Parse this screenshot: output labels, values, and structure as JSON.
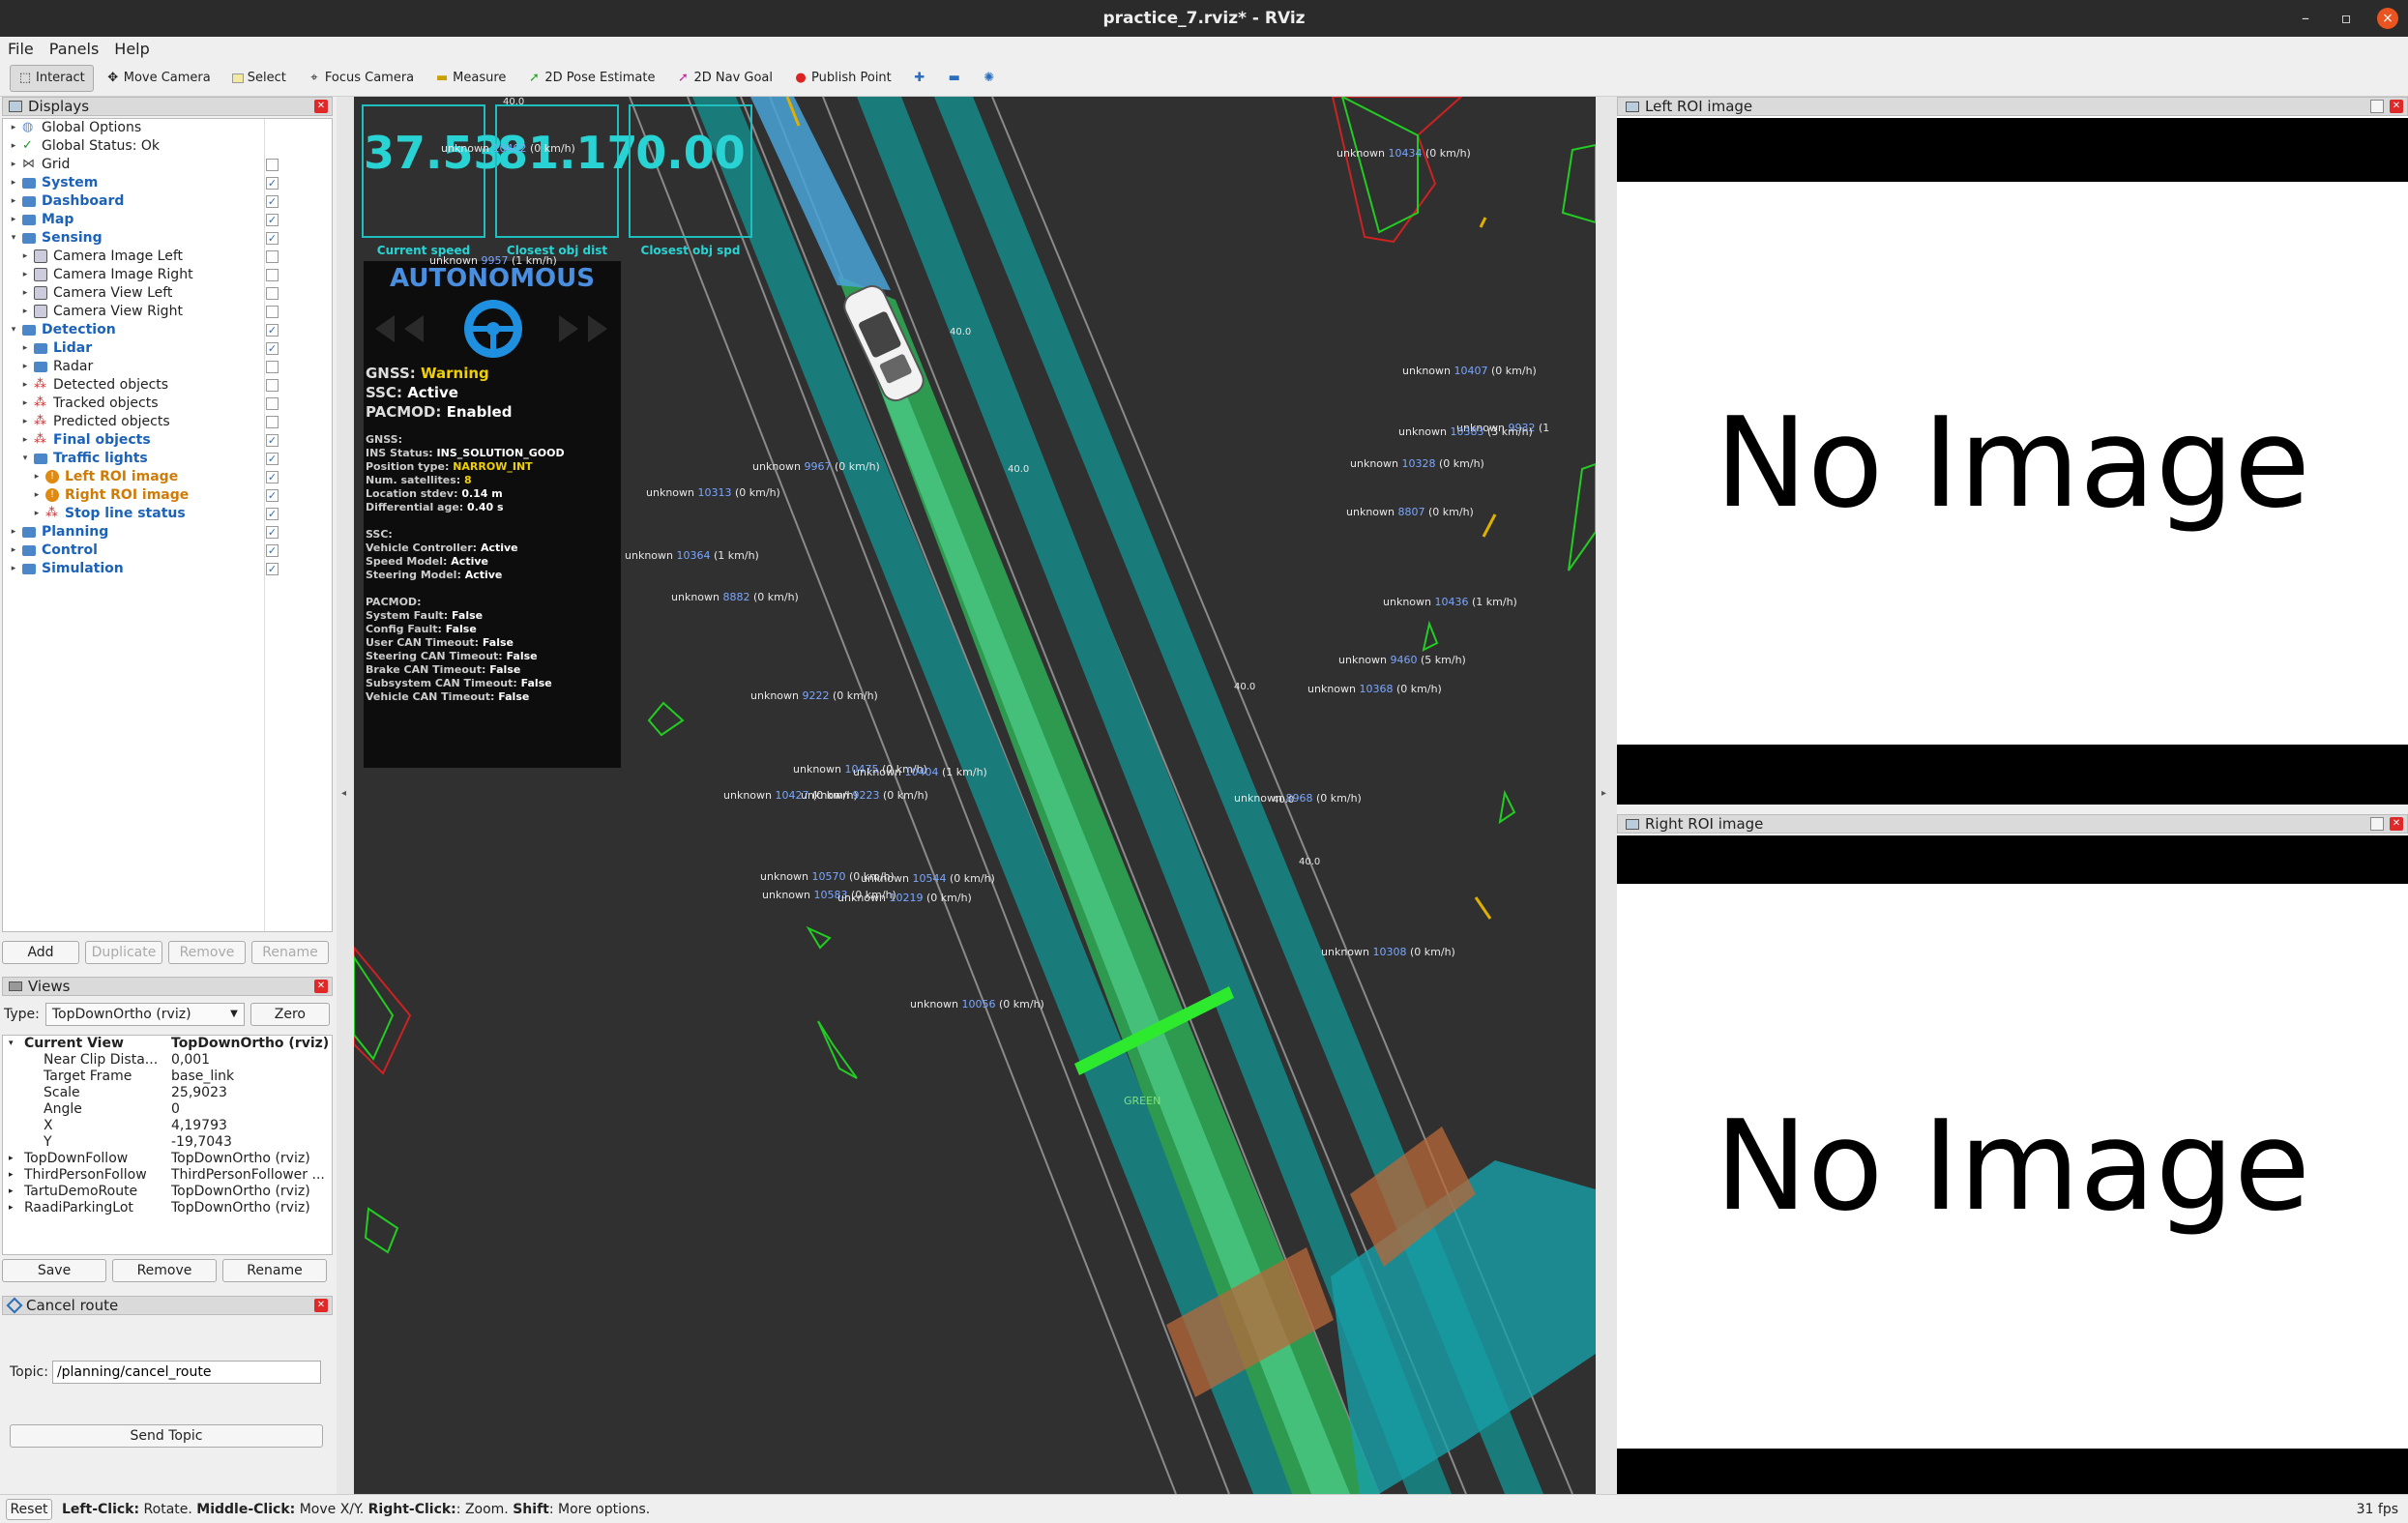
{
  "window": {
    "title": "practice_7.rviz* - RViz",
    "buttons": [
      "–",
      "▫",
      "×"
    ]
  },
  "menu": [
    "File",
    "Panels",
    "Help"
  ],
  "toolbar": [
    {
      "label": "Interact",
      "icon": "interact-icon",
      "active": true
    },
    {
      "label": "Move Camera",
      "icon": "move-camera-icon"
    },
    {
      "label": "Select",
      "icon": "select-icon"
    },
    {
      "label": "Focus Camera",
      "icon": "focus-camera-icon"
    },
    {
      "label": "Measure",
      "icon": "measure-icon"
    },
    {
      "label": "2D Pose Estimate",
      "icon": "pose-estimate-icon"
    },
    {
      "label": "2D Nav Goal",
      "icon": "nav-goal-icon"
    },
    {
      "label": "Publish Point",
      "icon": "publish-point-icon"
    }
  ],
  "displays_panel": {
    "title": "Displays",
    "items": [
      {
        "label": "Global Options",
        "depth": 0,
        "arrow": "▸",
        "style": "",
        "checked": null,
        "icon": "globe-icon"
      },
      {
        "label": "Global Status: Ok",
        "depth": 0,
        "arrow": "▸",
        "style": "",
        "checked": null,
        "icon": "check-icon"
      },
      {
        "label": "Grid",
        "depth": 0,
        "arrow": "▸",
        "style": "",
        "checked": false,
        "icon": "grid-icon"
      },
      {
        "label": "System",
        "depth": 0,
        "arrow": "▸",
        "style": "blue",
        "checked": true,
        "icon": "folder-icon"
      },
      {
        "label": "Dashboard",
        "depth": 0,
        "arrow": "▸",
        "style": "blue",
        "checked": true,
        "icon": "folder-icon"
      },
      {
        "label": "Map",
        "depth": 0,
        "arrow": "▸",
        "style": "blue",
        "checked": true,
        "icon": "folder-icon"
      },
      {
        "label": "Sensing",
        "depth": 0,
        "arrow": "▾",
        "style": "blue",
        "checked": true,
        "icon": "folder-icon"
      },
      {
        "label": "Camera Image Left",
        "depth": 1,
        "arrow": "▸",
        "style": "",
        "checked": false,
        "icon": "camera-icon"
      },
      {
        "label": "Camera Image Right",
        "depth": 1,
        "arrow": "▸",
        "style": "",
        "checked": false,
        "icon": "camera-icon"
      },
      {
        "label": "Camera View Left",
        "depth": 1,
        "arrow": "▸",
        "style": "",
        "checked": false,
        "icon": "camera-icon"
      },
      {
        "label": "Camera View Right",
        "depth": 1,
        "arrow": "▸",
        "style": "",
        "checked": false,
        "icon": "camera-icon"
      },
      {
        "label": "Detection",
        "depth": 0,
        "arrow": "▾",
        "style": "blue",
        "checked": true,
        "icon": "folder-icon"
      },
      {
        "label": "Lidar",
        "depth": 1,
        "arrow": "▸",
        "style": "blue",
        "checked": true,
        "icon": "folder-icon"
      },
      {
        "label": "Radar",
        "depth": 1,
        "arrow": "▸",
        "style": "",
        "checked": false,
        "icon": "folder-icon"
      },
      {
        "label": "Detected objects",
        "depth": 1,
        "arrow": "▸",
        "style": "",
        "checked": false,
        "icon": "markers-icon"
      },
      {
        "label": "Tracked objects",
        "depth": 1,
        "arrow": "▸",
        "style": "",
        "checked": false,
        "icon": "markers-icon"
      },
      {
        "label": "Predicted objects",
        "depth": 1,
        "arrow": "▸",
        "style": "",
        "checked": false,
        "icon": "markers-icon"
      },
      {
        "label": "Final objects",
        "depth": 1,
        "arrow": "▸",
        "style": "blue",
        "checked": true,
        "icon": "markers-icon"
      },
      {
        "label": "Traffic lights",
        "depth": 1,
        "arrow": "▾",
        "style": "blue",
        "checked": true,
        "icon": "folder-icon"
      },
      {
        "label": "Left ROI image",
        "depth": 2,
        "arrow": "▸",
        "style": "orange",
        "checked": true,
        "icon": "warning-icon"
      },
      {
        "label": "Right ROI image",
        "depth": 2,
        "arrow": "▸",
        "style": "orange",
        "checked": true,
        "icon": "warning-icon"
      },
      {
        "label": "Stop line status",
        "depth": 2,
        "arrow": "▸",
        "style": "blue",
        "checked": true,
        "icon": "markers-icon"
      },
      {
        "label": "Planning",
        "depth": 0,
        "arrow": "▸",
        "style": "blue",
        "checked": true,
        "icon": "folder-icon"
      },
      {
        "label": "Control",
        "depth": 0,
        "arrow": "▸",
        "style": "blue",
        "checked": true,
        "icon": "folder-icon"
      },
      {
        "label": "Simulation",
        "depth": 0,
        "arrow": "▸",
        "style": "blue",
        "checked": true,
        "icon": "folder-icon"
      }
    ],
    "buttons": [
      "Add",
      "Duplicate",
      "Remove",
      "Rename"
    ]
  },
  "views_panel": {
    "title": "Views",
    "type_label": "Type:",
    "type_value": "TopDownOrtho (rviz)",
    "zero_label": "Zero",
    "current_view": {
      "key": "Current View",
      "value": "TopDownOrtho (rviz)"
    },
    "props": [
      {
        "key": "Near Clip Dista...",
        "value": "0,001"
      },
      {
        "key": "Target Frame",
        "value": "base_link"
      },
      {
        "key": "Scale",
        "value": "25,9023"
      },
      {
        "key": "Angle",
        "value": "0"
      },
      {
        "key": "X",
        "value": "4,19793"
      },
      {
        "key": "Y",
        "value": "-19,7043"
      }
    ],
    "saved": [
      {
        "key": "TopDownFollow",
        "value": "TopDownOrtho (rviz)"
      },
      {
        "key": "ThirdPersonFollow",
        "value": "ThirdPersonFollower ..."
      },
      {
        "key": "TartuDemoRoute",
        "value": "TopDownOrtho (rviz)"
      },
      {
        "key": "RaadiParkingLot",
        "value": "TopDownOrtho (rviz)"
      }
    ],
    "buttons": [
      "Save",
      "Remove",
      "Rename"
    ]
  },
  "cancel_panel": {
    "title": "Cancel route",
    "topic_label": "Topic:",
    "topic_value": "/planning/cancel_route",
    "send_label": "Send Topic"
  },
  "dashboard": {
    "gauges": [
      {
        "value": "37.53",
        "label": "Current speed"
      },
      {
        "value": "81.17",
        "label": "Closest obj dist"
      },
      {
        "value": "0.00",
        "label": "Closest obj spd"
      }
    ],
    "mode": "AUTONOMOUS",
    "gnss_line": {
      "k": "GNSS:",
      "v": "Warning"
    },
    "ssc_line": {
      "k": "SSC:",
      "v": "Active"
    },
    "pacmod_line": {
      "k": "PACMOD:",
      "v": "Enabled"
    },
    "gnss_block": [
      {
        "k": "GNSS:",
        "v": ""
      },
      {
        "k": "INS Status:",
        "v": "INS_SOLUTION_GOOD"
      },
      {
        "k": "Position type:",
        "v": "NARROW_INT"
      },
      {
        "k": "Num. satellites:",
        "v": "8"
      },
      {
        "k": "Location stdev:",
        "v": "0.14 m"
      },
      {
        "k": "Differential age:",
        "v": "0.40 s"
      }
    ],
    "ssc_block": [
      {
        "k": "SSC:",
        "v": ""
      },
      {
        "k": "Vehicle Controller:",
        "v": "Active"
      },
      {
        "k": "Speed Model:",
        "v": "Active"
      },
      {
        "k": "Steering Model:",
        "v": "Active"
      }
    ],
    "pacmod_block": [
      {
        "k": "PACMOD:",
        "v": ""
      },
      {
        "k": "System Fault:",
        "v": "False"
      },
      {
        "k": "Config Fault:",
        "v": "False"
      },
      {
        "k": "User CAN Timeout:",
        "v": "False"
      },
      {
        "k": "Steering CAN Timeout:",
        "v": "False"
      },
      {
        "k": "Brake CAN Timeout:",
        "v": "False"
      },
      {
        "k": "Subsystem CAN Timeout:",
        "v": "False"
      },
      {
        "k": "Vehicle CAN Timeout:",
        "v": "False"
      }
    ]
  },
  "objects": [
    {
      "id": "10402",
      "speed": "(0 km/h)"
    },
    {
      "id": "10434",
      "speed": "(0 km/h)"
    },
    {
      "id": "9957",
      "speed": "(1 km/h)"
    },
    {
      "id": "10407",
      "speed": "(0 km/h)"
    },
    {
      "id": "9932",
      "speed": "(1"
    },
    {
      "id": "10383",
      "speed": "(3 km/h)"
    },
    {
      "id": "10328",
      "speed": "(0 km/h)"
    },
    {
      "id": "9967",
      "speed": "(0 km/h)"
    },
    {
      "id": "10313",
      "speed": "(0 km/h)"
    },
    {
      "id": "8807",
      "speed": "(0 km/h)"
    },
    {
      "id": "10364",
      "speed": "(1 km/h)"
    },
    {
      "id": "8882",
      "speed": "(0 km/h)"
    },
    {
      "id": "10436",
      "speed": "(1 km/h)"
    },
    {
      "id": "9460",
      "speed": "(5 km/h)"
    },
    {
      "id": "10368",
      "speed": "(0 km/h)"
    },
    {
      "id": "9222",
      "speed": "(0 km/h)"
    },
    {
      "id": "10475",
      "speed": "(0 km/h)"
    },
    {
      "id": "10404",
      "speed": "(1 km/h)"
    },
    {
      "id": "10427",
      "speed": "(0 km/h)"
    },
    {
      "id": "9223",
      "speed": "(0 km/h)"
    },
    {
      "id": "8968",
      "speed": "(0 km/h)"
    },
    {
      "id": "10570",
      "speed": "(0 km/h)"
    },
    {
      "id": "10544",
      "speed": "(0 km/h)"
    },
    {
      "id": "10583",
      "speed": "(0 km/h)"
    },
    {
      "id": "10219",
      "speed": "(0 km/h)"
    },
    {
      "id": "10308",
      "speed": "(0 km/h)"
    },
    {
      "id": "10056",
      "speed": "(0 km/h)"
    }
  ],
  "object_class": "unknown",
  "lane_speeds": [
    "40.0",
    "40.0",
    "40.0",
    "40.0",
    "40.0",
    "40.0"
  ],
  "stop_line_label": "GREEN",
  "right_panels": [
    {
      "title": "Left ROI image",
      "text": "No Image"
    },
    {
      "title": "Right ROI image",
      "text": "No Image"
    }
  ],
  "statusbar": {
    "reset": "Reset",
    "hint": [
      {
        "b": "Left-Click:",
        "t": " Rotate. "
      },
      {
        "b": "Middle-Click:",
        "t": " Move X/Y. "
      },
      {
        "b": "Right-Click:",
        "t": ": Zoom. "
      },
      {
        "b": "Shift",
        "t": ": More options."
      }
    ],
    "fps": "31 fps"
  },
  "colors": {
    "accent": "#1fbfbf",
    "lane_green": "#3ecf7a",
    "lane_teal": "#1f8c8c",
    "object_green": "#22cc22",
    "warning": "#e0b000"
  }
}
